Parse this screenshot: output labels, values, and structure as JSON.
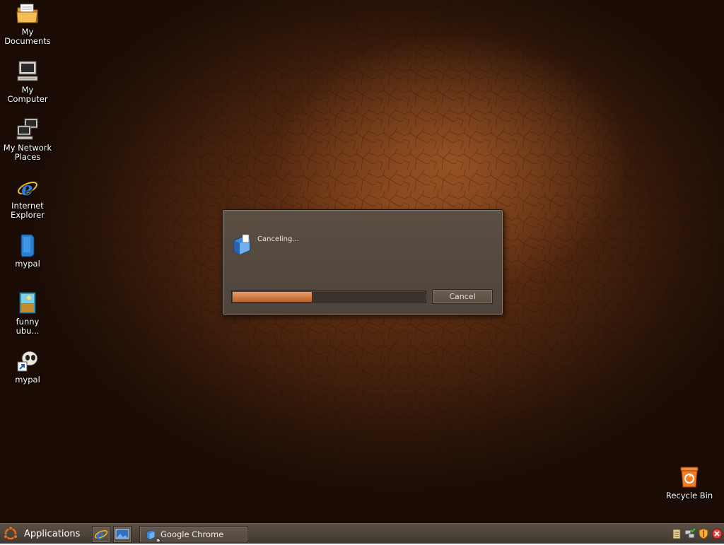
{
  "desktop": {
    "icons": [
      {
        "label_line1": "My",
        "label_line2": "Documents",
        "icon": "folder-documents-icon"
      },
      {
        "label_line1": "My",
        "label_line2": "Computer",
        "icon": "computer-icon"
      },
      {
        "label_line1": "My Network",
        "label_line2": "Places",
        "icon": "network-places-icon"
      },
      {
        "label_line1": "Internet",
        "label_line2": "Explorer",
        "icon": "internet-explorer-icon"
      },
      {
        "label_line1": "mypal",
        "label_line2": "",
        "icon": "mypal-app-icon"
      },
      {
        "label_line1": "funny",
        "label_line2": "ubu...",
        "icon": "image-file-icon"
      },
      {
        "label_line1": "mypal",
        "label_line2": "",
        "icon": "mypal-shortcut-icon"
      }
    ],
    "recycle_bin": {
      "label": "Recycle Bin",
      "icon": "recycle-bin-icon"
    }
  },
  "dialog": {
    "status_text": "Canceling...",
    "cancel_label": "Cancel",
    "progress": 0.41,
    "icon": "setup-installer-icon"
  },
  "taskbar": {
    "applications_label": "Applications",
    "quick_launch": [
      {
        "icon": "internet-explorer-icon"
      },
      {
        "icon": "show-desktop-icon"
      }
    ],
    "tasks": [
      {
        "label": "Google Chrome",
        "icon": "setup-installer-icon"
      }
    ],
    "tray_icons": [
      "clipboard-icon",
      "network-icon",
      "security-shield-icon",
      "close-circle-icon"
    ]
  },
  "colors": {
    "progress_fill": "#d27a42",
    "wallpaper_accent": "#7a3d17"
  }
}
